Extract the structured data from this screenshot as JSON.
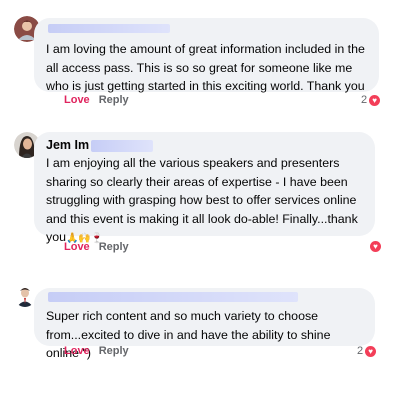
{
  "comments": [
    {
      "author": "",
      "text": "I am loving the amount of great information included in the all access pass. This is so so great for someone like me who is just getting started in this exciting world. Thank you",
      "emoji": "",
      "actions": {
        "love": "Love",
        "reply": "Reply"
      },
      "reaction_count": "2",
      "reaction_icon": "heart-icon"
    },
    {
      "author": "Jem Im",
      "text": "I am enjoying all the various speakers and presenters sharing so clearly their areas of expertise - I have been struggling with grasping how best to offer services online and this event is making it all look do-able! Finally...thank you",
      "emoji": "🙏🙌🍷",
      "actions": {
        "love": "Love",
        "reply": "Reply"
      },
      "reaction_count": "",
      "reaction_icon": "heart-icon"
    },
    {
      "author": "",
      "text": "Super rich content and so much variety to choose from...excited to dive in and have the ability to shine online \")",
      "emoji": "",
      "actions": {
        "love": "Love",
        "reply": "Reply"
      },
      "reaction_count": "2",
      "reaction_icon": "heart-icon"
    }
  ],
  "colors": {
    "bubble": "#f0f2f5",
    "love": "#e0245e",
    "meta": "#65676b",
    "heart": "#f33e58",
    "redaction": "#c6cdf6"
  }
}
